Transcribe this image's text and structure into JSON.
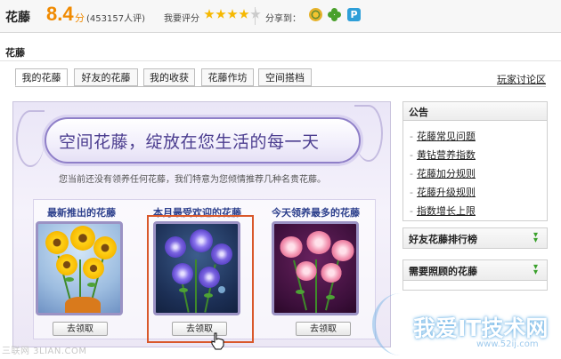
{
  "header": {
    "app_title": "花藤",
    "score": "8.4",
    "score_unit": "分",
    "review_count": "(453157人评)",
    "rate_label": "我要评分",
    "rating_stars": 4,
    "rating_max": 5,
    "share_label": "分享到："
  },
  "section_title": "花藤",
  "tabs": [
    {
      "label": "我的花藤"
    },
    {
      "label": "好友的花藤"
    },
    {
      "label": "我的收获"
    },
    {
      "label": "花藤作坊"
    },
    {
      "label": "空间搭档"
    }
  ],
  "forum_link": "玩家讨论区",
  "banner": {
    "headline": "空间花藤，绽放在您生活的每一天",
    "subline": "您当前还没有领养任何花藤，我们特意为您倾情推荐几种名贵花藤。",
    "cards": [
      {
        "title": "最新推出的花藤",
        "button": "去领取"
      },
      {
        "title": "本月最受欢迎的花藤",
        "button": "去领取"
      },
      {
        "title": "今天领养最多的花藤",
        "button": "去领取"
      }
    ]
  },
  "sidebar": {
    "notice_title": "公告",
    "notice_items": [
      "花藤常见问题",
      "黄钻营养指数",
      "花藤加分规则",
      "花藤升级规则",
      "指数增长上限"
    ],
    "rank_title": "好友花藤排行榜",
    "care_title": "需要照顾的花藤"
  },
  "watermarks": {
    "left": "三联网 3LIAN.COM",
    "right": "我爱IT技术网",
    "right_sub": "www.52ij.com"
  },
  "colors": {
    "score": "#f08a00",
    "star": "#f6b800",
    "highlight": "#d9582b",
    "headline": "#4b3d8f",
    "card_title": "#2c3f8c"
  }
}
